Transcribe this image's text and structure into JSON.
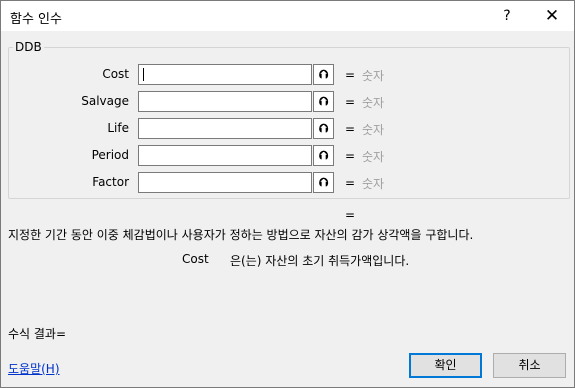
{
  "dialog": {
    "title": "함수 인수",
    "help_glyph": "?",
    "close_glyph": "✕"
  },
  "group": {
    "label": "DDB"
  },
  "arguments": [
    {
      "label": "Cost",
      "value": "",
      "equals": "=",
      "type": "숫자"
    },
    {
      "label": "Salvage",
      "value": "",
      "equals": "=",
      "type": "숫자"
    },
    {
      "label": "Life",
      "value": "",
      "equals": "=",
      "type": "숫자"
    },
    {
      "label": "Period",
      "value": "",
      "equals": "=",
      "type": "숫자"
    },
    {
      "label": "Factor",
      "value": "",
      "equals": "=",
      "type": "숫자"
    }
  ],
  "ref_glyph": "⮉",
  "result_equals": "=",
  "description": "지정한 기간 동안 이중 체감법이나 사용자가 정하는 방법으로 자산의 감가 상각액을 구합니다.",
  "arg_description": {
    "name": "Cost",
    "text": "은(는) 자산의 초기 취득가액입니다."
  },
  "formula_result_label": "수식 결과=",
  "help_link": "도움말(H)",
  "buttons": {
    "ok": "확인",
    "cancel": "취소"
  }
}
